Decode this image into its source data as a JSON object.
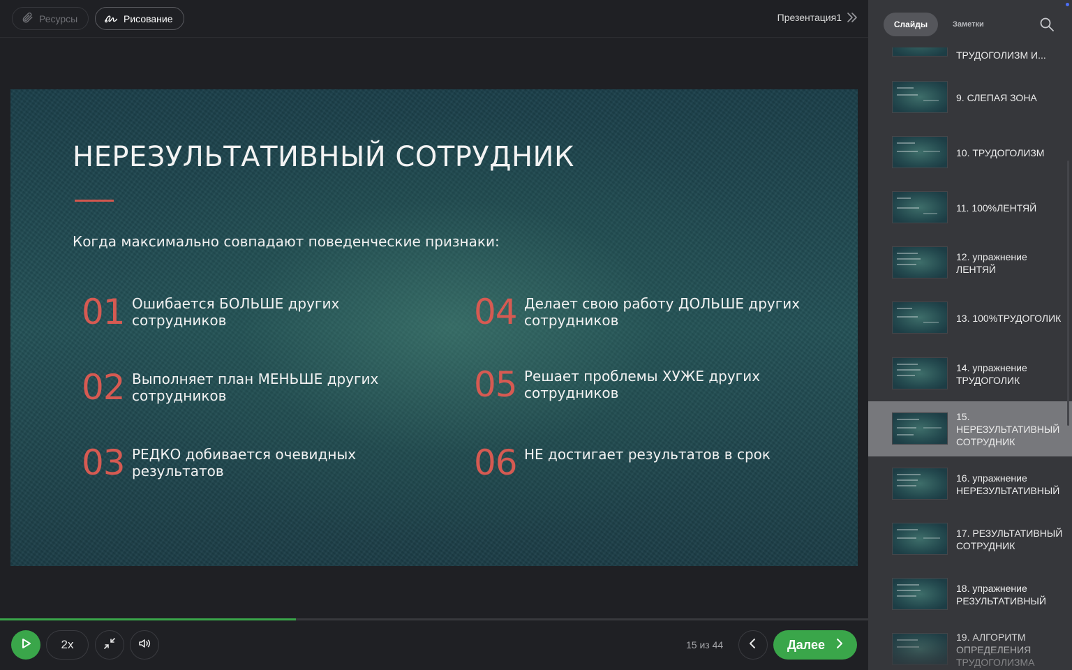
{
  "toolbar": {
    "resources_label": "Ресурсы",
    "drawing_label": "Рисование",
    "presentation_title": "Презентация1"
  },
  "slide": {
    "title": "НЕРЕЗУЛЬТАТИВНЫЙ СОТРУДНИК",
    "subtitle": "Когда максимально совпадают поведенческие признаки:",
    "accent_color": "#d65a52",
    "items": [
      {
        "num": "01",
        "text": "Ошибается БОЛЬШЕ других сотрудников"
      },
      {
        "num": "02",
        "text": "Выполняет план МЕНЬШЕ других сотрудников"
      },
      {
        "num": "03",
        "text": "РЕДКО добивается очевидных результатов"
      },
      {
        "num": "04",
        "text": "Делает свою работу ДОЛЬШЕ других сотрудников"
      },
      {
        "num": "05",
        "text": "Решает проблемы ХУЖЕ других сотрудников"
      },
      {
        "num": "06",
        "text": "НЕ достигает результатов в срок"
      }
    ]
  },
  "player": {
    "speed_label": "2x",
    "page_counter": "15 из 44",
    "next_label": "Далее",
    "progress_fraction": 0.341,
    "accent_color": "#3aa64a"
  },
  "sidebar": {
    "tab_slides": "Слайды",
    "tab_notes": "Заметки",
    "slides": [
      {
        "label": "ТРУДОГОЛИЗМ И...",
        "active": false
      },
      {
        "label": "9. СЛЕПАЯ ЗОНА",
        "active": false
      },
      {
        "label": "10. ТРУДОГОЛИЗМ",
        "active": false
      },
      {
        "label": "11. 100%ЛЕНТЯЙ",
        "active": false
      },
      {
        "label": "12. упражнение ЛЕНТЯЙ",
        "active": false
      },
      {
        "label": "13. 100%ТРУДОГОЛИК",
        "active": false
      },
      {
        "label": "14. упражнение ТРУДОГОЛИК",
        "active": false
      },
      {
        "label": "15. НЕРЕЗУЛЬТАТИВНЫЙ СОТРУДНИК",
        "active": true
      },
      {
        "label": "16. упражнение НЕРЕЗУЛЬТАТИВНЫЙ",
        "active": false
      },
      {
        "label": "17. РЕЗУЛЬТАТИВНЫЙ СОТРУДНИК",
        "active": false
      },
      {
        "label": "18. упражнение РЕЗУЛЬТАТИВНЫЙ",
        "active": false
      },
      {
        "label": "19. АЛГОРИТМ ОПРЕДЕЛЕНИЯ ТРУДОГОЛИЗМА",
        "active": false
      }
    ]
  }
}
